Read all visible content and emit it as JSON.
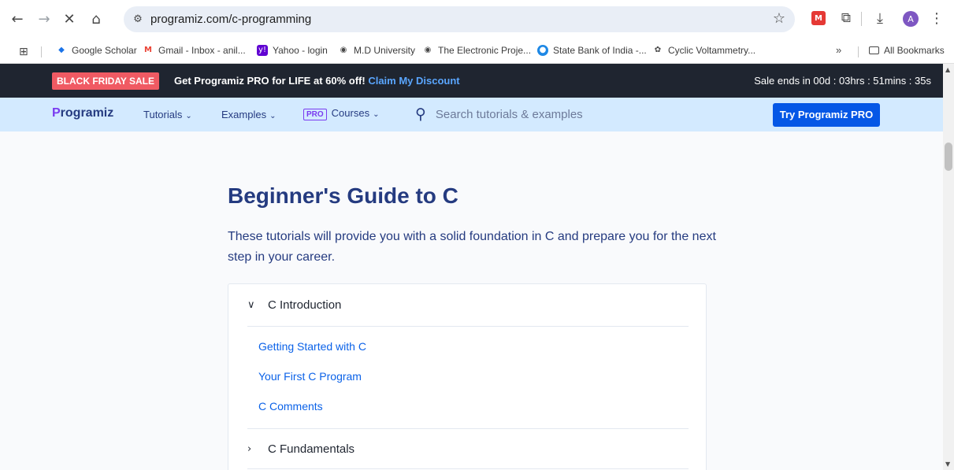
{
  "browser": {
    "url": "programiz.com/c-programming",
    "icons": [
      "back-icon",
      "forward-icon",
      "close-icon",
      "home-icon",
      "tune-icon",
      "star-icon",
      "puzzle-icon",
      "download-icon",
      "menu-icon"
    ],
    "profile_initial": "A",
    "bookmarks": [
      {
        "label": "Google Scholar",
        "icon": "scholar-icon",
        "color": "#1a73e8"
      },
      {
        "label": "Gmail - Inbox - anil...",
        "icon": "gmail-icon",
        "color": "#ea4335"
      },
      {
        "label": "Yahoo - login",
        "icon": "yahoo-icon",
        "color": "#6001d2"
      },
      {
        "label": "M.D University",
        "icon": "globe-icon",
        "color": "#474747"
      },
      {
        "label": "The Electronic Proje...",
        "icon": "globe-icon",
        "color": "#474747"
      },
      {
        "label": "State Bank of India -...",
        "icon": "sbi-icon",
        "color": "#1e88e5"
      },
      {
        "label": "Cyclic Voltammetry...",
        "icon": "chatgpt-icon",
        "color": "#474747"
      }
    ],
    "bookmarks_more": "»",
    "all_bookmarks": "All Bookmarks"
  },
  "promo": {
    "badge": "BLACK FRIDAY SALE",
    "text": "Get Programiz PRO for LIFE at 60% off!",
    "claim": "Claim My Discount",
    "timer": "Sale ends in 00d : 03hrs : 51mins : 35s"
  },
  "nav": {
    "logo": "Programiz",
    "tutorials": "Tutorials",
    "examples": "Examples",
    "pro_tag": "PRO",
    "courses": "Courses",
    "search_placeholder": "Search tutorials & examples",
    "try_button": "Try Programiz PRO"
  },
  "main": {
    "title": "Beginner's Guide to C",
    "intro": "These tutorials will provide you with a solid foundation in C and prepare you for the next step in your career.",
    "sections": [
      {
        "title": "C Introduction",
        "expanded": true,
        "lessons": [
          "Getting Started with C",
          "Your First C Program",
          "C Comments"
        ]
      },
      {
        "title": "C Fundamentals",
        "expanded": false,
        "lessons": []
      }
    ]
  },
  "colors": {
    "promo_bg": "#1f2530",
    "nav_bg": "#d3eaff",
    "brand": "#253b80",
    "accent": "#0557e6",
    "badge": "#f05a63",
    "link": "#0b62e8"
  }
}
